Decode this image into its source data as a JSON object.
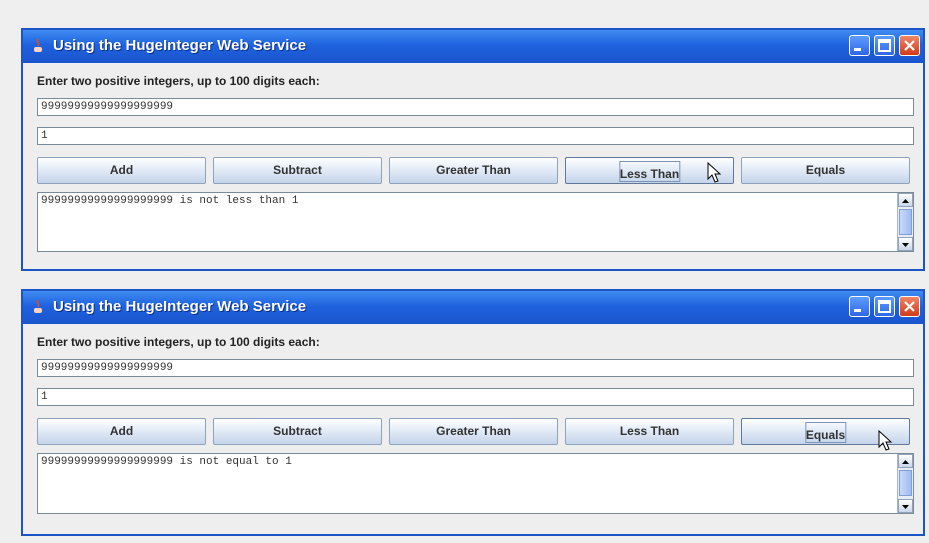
{
  "windows": [
    {
      "title": "Using the HugeInteger Web Service",
      "prompt": "Enter two positive integers, up to 100 digits each:",
      "first_integer": "99999999999999999999",
      "second_integer": "1",
      "buttons": [
        "Add",
        "Subtract",
        "Greater Than",
        "Less Than",
        "Equals"
      ],
      "active_button": "Less Than",
      "result": "99999999999999999999 is not less than 1"
    },
    {
      "title": "Using the HugeInteger Web Service",
      "prompt": "Enter two positive integers, up to 100 digits each:",
      "first_integer": "99999999999999999999",
      "second_integer": "1",
      "buttons": [
        "Add",
        "Subtract",
        "Greater Than",
        "Less Than",
        "Equals"
      ],
      "active_button": "Equals",
      "result": "99999999999999999999 is not equal to 1"
    }
  ],
  "icons": {
    "app": "java-cup-icon",
    "minimize": "minimize-icon",
    "maximize": "maximize-icon",
    "close": "close-icon",
    "cursor": "mouse-pointer-icon",
    "scroll_up": "arrow-up-icon",
    "scroll_down": "arrow-down-icon"
  },
  "colors": {
    "titlebar": "#1f62df",
    "close_button": "#d13b19",
    "window_bg": "#eeeeee"
  }
}
